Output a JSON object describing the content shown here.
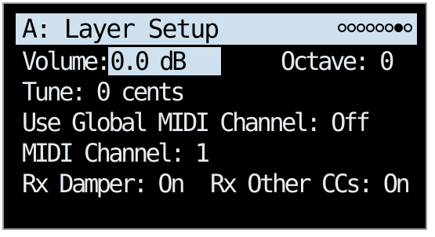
{
  "header": {
    "title": "A: Layer Setup",
    "page_count": 8,
    "active_page": 7
  },
  "params": {
    "volume_label": "Volume:",
    "volume_value": "0.0 dB",
    "octave": "Octave: 0",
    "tune": "Tune: 0 cents",
    "global_midi": "Use Global MIDI Channel: Off",
    "midi_channel": "MIDI Channel: 1",
    "rx_damper": "Rx Damper: On",
    "rx_other": "Rx Other CCs: On"
  },
  "colors": {
    "highlight": "#cfe0ee",
    "background": "#000000",
    "text": "#e6ecf2"
  }
}
